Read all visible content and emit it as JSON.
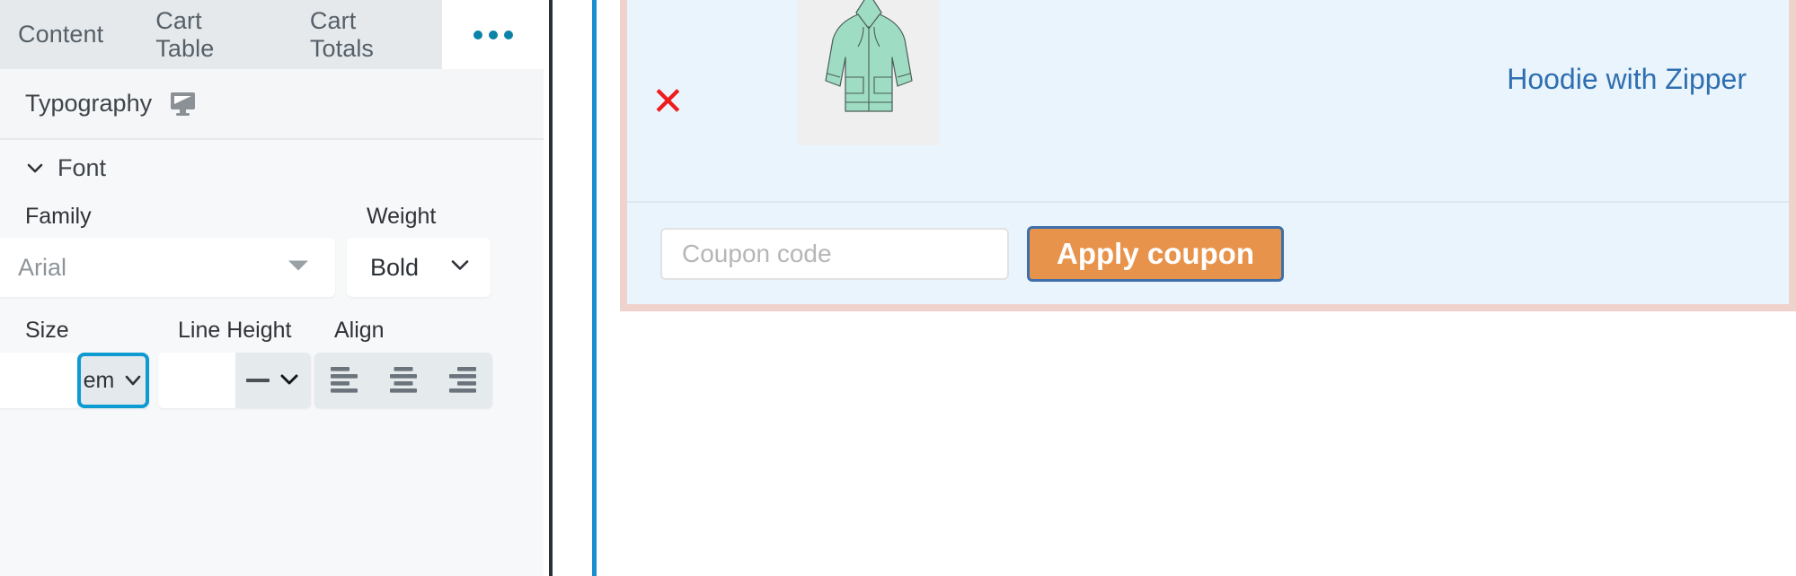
{
  "editor": {
    "tabs": [
      {
        "label": "Content",
        "active": false
      },
      {
        "label": "Cart Table",
        "active": false
      },
      {
        "label": "Cart Totals",
        "active": false
      },
      {
        "label": "•••",
        "active": true,
        "icon": "more-dots-icon"
      }
    ],
    "section": {
      "title": "Typography",
      "device_icon": "monitor-icon"
    },
    "font_group": {
      "label": "Font",
      "collapse_icon": "chevron-down-icon",
      "expanded": true
    },
    "fields": {
      "family": {
        "label": "Family",
        "value": "Arial",
        "is_placeholder": true,
        "icon": "caret-down-icon"
      },
      "weight": {
        "label": "Weight",
        "value": "Bold",
        "icon": "chevron-down-icon"
      },
      "size": {
        "label": "Size",
        "value": "",
        "unit": "em",
        "unit_icon": "chevron-down-icon",
        "focused": true
      },
      "line_height": {
        "label": "Line Height",
        "value": "",
        "unit": "—",
        "unit_icon": "chevron-down-icon",
        "focused": false
      },
      "align": {
        "label": "Align",
        "options": [
          {
            "name": "align-left-icon",
            "value": "left",
            "selected": false
          },
          {
            "name": "align-center-icon",
            "value": "center",
            "selected": false
          },
          {
            "name": "align-right-icon",
            "value": "right",
            "selected": false
          }
        ]
      }
    }
  },
  "preview": {
    "cart": {
      "remove_label": "✕",
      "remove_icon": "remove-item-icon",
      "product_image_alt": "hoodie-with-zipper-thumbnail",
      "product_name": "Hoodie with Zipper"
    },
    "coupon": {
      "placeholder": "Coupon code",
      "value": "",
      "button_label": "Apply coupon"
    }
  },
  "colors": {
    "accent_blue": "#0d9bd1",
    "tabbar_bg": "#e6e9ec",
    "panel_bg": "#f7f8f9",
    "cart_bg": "#eaf4fd",
    "cart_border": "#f0d2cc",
    "link_blue": "#2f6fb0",
    "button_orange": "#e8934b",
    "button_border": "#3e6fa8",
    "remove_red": "#ee1c1c",
    "divider_dark": "#2b3036",
    "divider_blue": "#1a8fd0"
  }
}
